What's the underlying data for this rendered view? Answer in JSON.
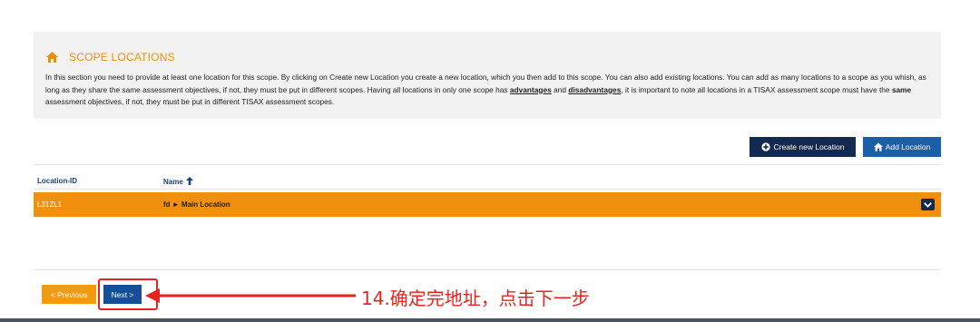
{
  "scope_locations": {
    "title": "SCOPE LOCATIONS",
    "text_part1": "In this section you need to provide at least one location for this scope. By clicking on Create new Location you create a new location, which you then add to this scope. You can also add existing locations. You can add as many locations to a scope as you whish, as long as they share the same assessment objectives, if not, they must be put in different scopes. Having all locations in only one scope has ",
    "link_advantages": "advantages",
    "text_and": " and ",
    "link_disadvantages": "disadvantages",
    "text_part2": ", it is important to note all locations in a TISAX assessment scope must have the ",
    "text_same": "same",
    "text_part3": " assessment objectives, if not, they must be put in different TISAX assessment scopes."
  },
  "actions": {
    "create_new_location": "Create new Location",
    "add_location": "Add Location"
  },
  "table": {
    "columns": [
      "Location-ID",
      "Name"
    ],
    "sort_indicator": "ascending",
    "rows": [
      {
        "location_id": "L31ZL1",
        "name": "fd ► Main Location"
      }
    ]
  },
  "navigation": {
    "previous": "< Previous",
    "next": "Next >"
  },
  "annotation": {
    "text": "14.确定完地址，点击下一步",
    "color": "#e8231f"
  },
  "colors": {
    "accent_orange": "#f0900e",
    "navy": "#14294f",
    "blue": "#1a5fa8"
  }
}
